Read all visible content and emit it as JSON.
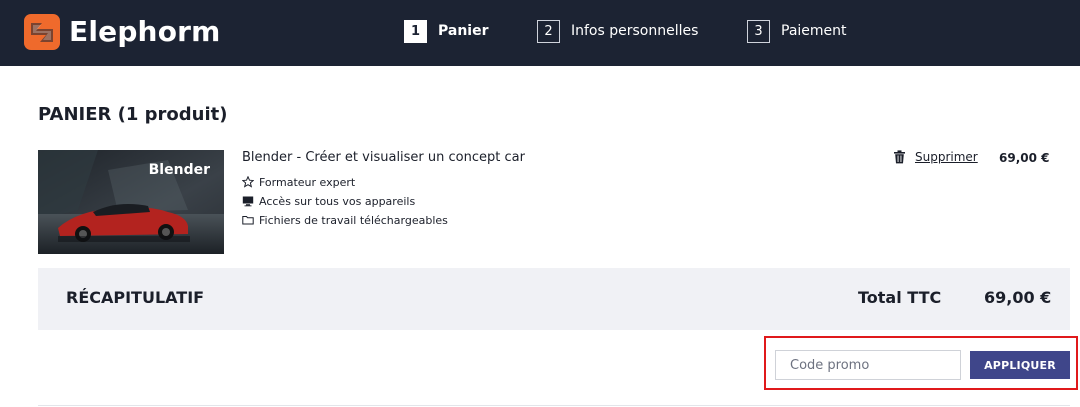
{
  "header": {
    "brand": "Elephorm",
    "brand_color": "#ef6a2c",
    "background": "#1c2333",
    "steps": [
      {
        "number": "1",
        "label": "Panier",
        "active": true
      },
      {
        "number": "2",
        "label": "Infos personnelles",
        "active": false
      },
      {
        "number": "3",
        "label": "Paiement",
        "active": false
      }
    ]
  },
  "cart": {
    "title": "PANIER (1 produit)",
    "items": [
      {
        "thumbnail_title": "Blender",
        "name": "Blender - Créer et visualiser un concept car",
        "features": [
          {
            "icon": "star-outline-icon",
            "text": "Formateur expert"
          },
          {
            "icon": "monitor-icon",
            "text": "Accès sur tous vos appareils"
          },
          {
            "icon": "folder-icon",
            "text": "Fichiers de travail téléchargeables"
          }
        ],
        "remove_icon": "trash-icon",
        "remove_label": "Supprimer",
        "price": "69,00 €"
      }
    ]
  },
  "summary": {
    "title": "RÉCAPITULATIF",
    "total_label": "Total TTC",
    "total_value": "69,00 €"
  },
  "promo": {
    "placeholder": "Code promo",
    "value": "",
    "button_label": "APPLIQUER",
    "button_color": "#3f468a",
    "highlight_color": "#e0191b"
  }
}
